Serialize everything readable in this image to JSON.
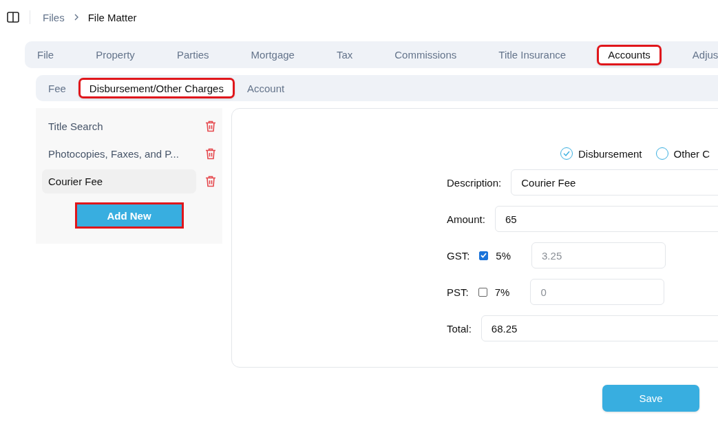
{
  "breadcrumb": [
    {
      "label": "Files",
      "current": false
    },
    {
      "label": "File Matter",
      "current": true
    }
  ],
  "tabs": [
    {
      "label": "File",
      "selected": false,
      "highlighted": false
    },
    {
      "label": "Property",
      "selected": false,
      "highlighted": false
    },
    {
      "label": "Parties",
      "selected": false,
      "highlighted": false
    },
    {
      "label": "Mortgage",
      "selected": false,
      "highlighted": false
    },
    {
      "label": "Tax",
      "selected": false,
      "highlighted": false
    },
    {
      "label": "Commissions",
      "selected": false,
      "highlighted": false
    },
    {
      "label": "Title Insurance",
      "selected": false,
      "highlighted": false
    },
    {
      "label": "Accounts",
      "selected": true,
      "highlighted": true
    },
    {
      "label": "Adjus",
      "selected": false,
      "highlighted": false
    }
  ],
  "subtabs": [
    {
      "label": "Fee",
      "selected": false,
      "highlighted": false
    },
    {
      "label": "Disbursement/Other Charges",
      "selected": true,
      "highlighted": true
    },
    {
      "label": "Account",
      "selected": false,
      "highlighted": false
    }
  ],
  "items": [
    {
      "label": "Title Search",
      "selected": false
    },
    {
      "label": "Photocopies, Faxes, and P...",
      "selected": false
    },
    {
      "label": "Courier Fee",
      "selected": true
    }
  ],
  "add_button": {
    "label": "Add New",
    "highlighted": true
  },
  "form": {
    "types": [
      {
        "label": "Disbursement",
        "selected": true
      },
      {
        "label": "Other C",
        "selected": false
      }
    ],
    "description": {
      "label": "Description:",
      "value": "Courier Fee"
    },
    "amount": {
      "label": "Amount:",
      "value": "65"
    },
    "taxes": [
      {
        "label": "GST:",
        "checked": true,
        "rate": "5%",
        "value": "3.25",
        "disabled": true
      },
      {
        "label": "PST:",
        "checked": false,
        "rate": "7%",
        "value": "0",
        "disabled": true
      }
    ],
    "total": {
      "label": "Total:",
      "value": "68.25"
    }
  },
  "save_button": {
    "label": "Save"
  }
}
